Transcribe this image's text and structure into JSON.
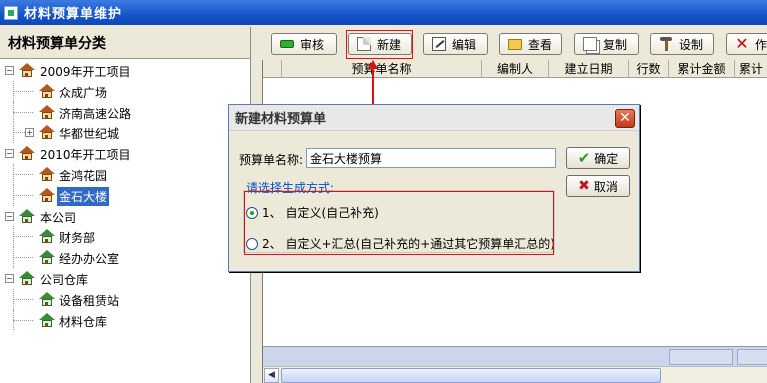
{
  "window": {
    "title": "材料预算单维护"
  },
  "left_panel": {
    "title": "材料预算单分类",
    "tree": [
      {
        "label": "2009年开工项目",
        "level": 0,
        "expander": "−",
        "icon": "house-icon"
      },
      {
        "label": "众成广场",
        "level": 1,
        "icon": "house-icon"
      },
      {
        "label": "济南高速公路",
        "level": 1,
        "icon": "house-icon"
      },
      {
        "label": "华都世纪城",
        "level": 1,
        "expander": "+",
        "icon": "house-icon"
      },
      {
        "label": "2010年开工项目",
        "level": 0,
        "expander": "−",
        "icon": "house-icon"
      },
      {
        "label": "金鸿花园",
        "level": 1,
        "icon": "house-icon"
      },
      {
        "label": "金石大楼",
        "level": 1,
        "icon": "house-icon",
        "selected": true
      },
      {
        "label": "本公司",
        "level": 0,
        "expander": "−",
        "icon": "green-house-icon"
      },
      {
        "label": "财务部",
        "level": 1,
        "icon": "green-house-icon"
      },
      {
        "label": "经办办公室",
        "level": 1,
        "icon": "green-house-icon"
      },
      {
        "label": "公司仓库",
        "level": 0,
        "expander": "−",
        "icon": "green-house-icon"
      },
      {
        "label": "设备租赁站",
        "level": 1,
        "icon": "green-house-icon"
      },
      {
        "label": "材料仓库",
        "level": 1,
        "icon": "green-house-icon"
      }
    ]
  },
  "toolbar": {
    "audit": "审核",
    "new": "新建",
    "edit": "编辑",
    "view": "查看",
    "copy": "复制",
    "design": "设制",
    "delete": "作"
  },
  "grid": {
    "columns": [
      "预算单名称",
      "编制人",
      "建立日期",
      "行数",
      "累计金额",
      "累计"
    ]
  },
  "dialog": {
    "title": "新建材料预算单",
    "name_label": "预算单名称:",
    "name_value": "金石大楼预算",
    "ok": "确定",
    "cancel": "取消",
    "mode_legend": "请选择生成方式:",
    "option1": "1、 自定义(自己补充)",
    "option2": "2、 自定义+汇总(自己补充的+通过其它预算单汇总的)",
    "selected_option": 1
  },
  "colors": {
    "titlebar": "#1654c9",
    "selection": "#316ac5",
    "highlight": "#e01010",
    "legend_text": "#0050c8"
  }
}
